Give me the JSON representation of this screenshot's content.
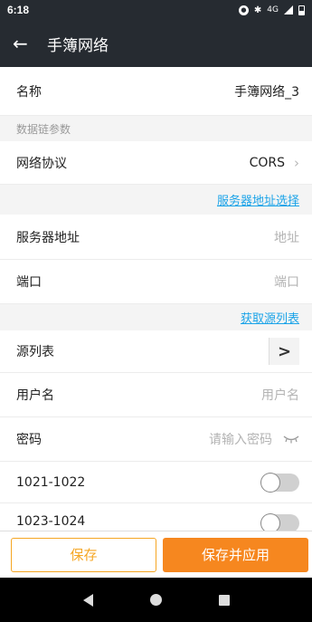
{
  "status": {
    "time": "6:18",
    "notif_badge": "⓿",
    "bluetooth": "✱",
    "network": "4G"
  },
  "header": {
    "title": "手簿网络"
  },
  "name": {
    "label": "名称",
    "value": "手簿网络_3"
  },
  "section": {
    "label": "数据链参数"
  },
  "protocol": {
    "label": "网络协议",
    "value": "CORS"
  },
  "server_select": {
    "label": "服务器地址选择"
  },
  "server": {
    "label": "服务器地址",
    "placeholder": "地址"
  },
  "port": {
    "label": "端口",
    "placeholder": "端口"
  },
  "fetch_source": {
    "label": "获取源列表"
  },
  "source_table": {
    "label": "源列表"
  },
  "username": {
    "label": "用户名",
    "placeholder": "用户名"
  },
  "password": {
    "label": "密码",
    "placeholder": "请输入密码"
  },
  "toggle1": {
    "label": "1021-1022",
    "on": false
  },
  "toggle2": {
    "label": "1023-1024",
    "on": false
  },
  "actions": {
    "save": "保存",
    "save_apply": "保存并应用"
  },
  "colors": {
    "header_bg": "#262b31",
    "accent": "#f6871f",
    "link": "#1aa3e8"
  }
}
